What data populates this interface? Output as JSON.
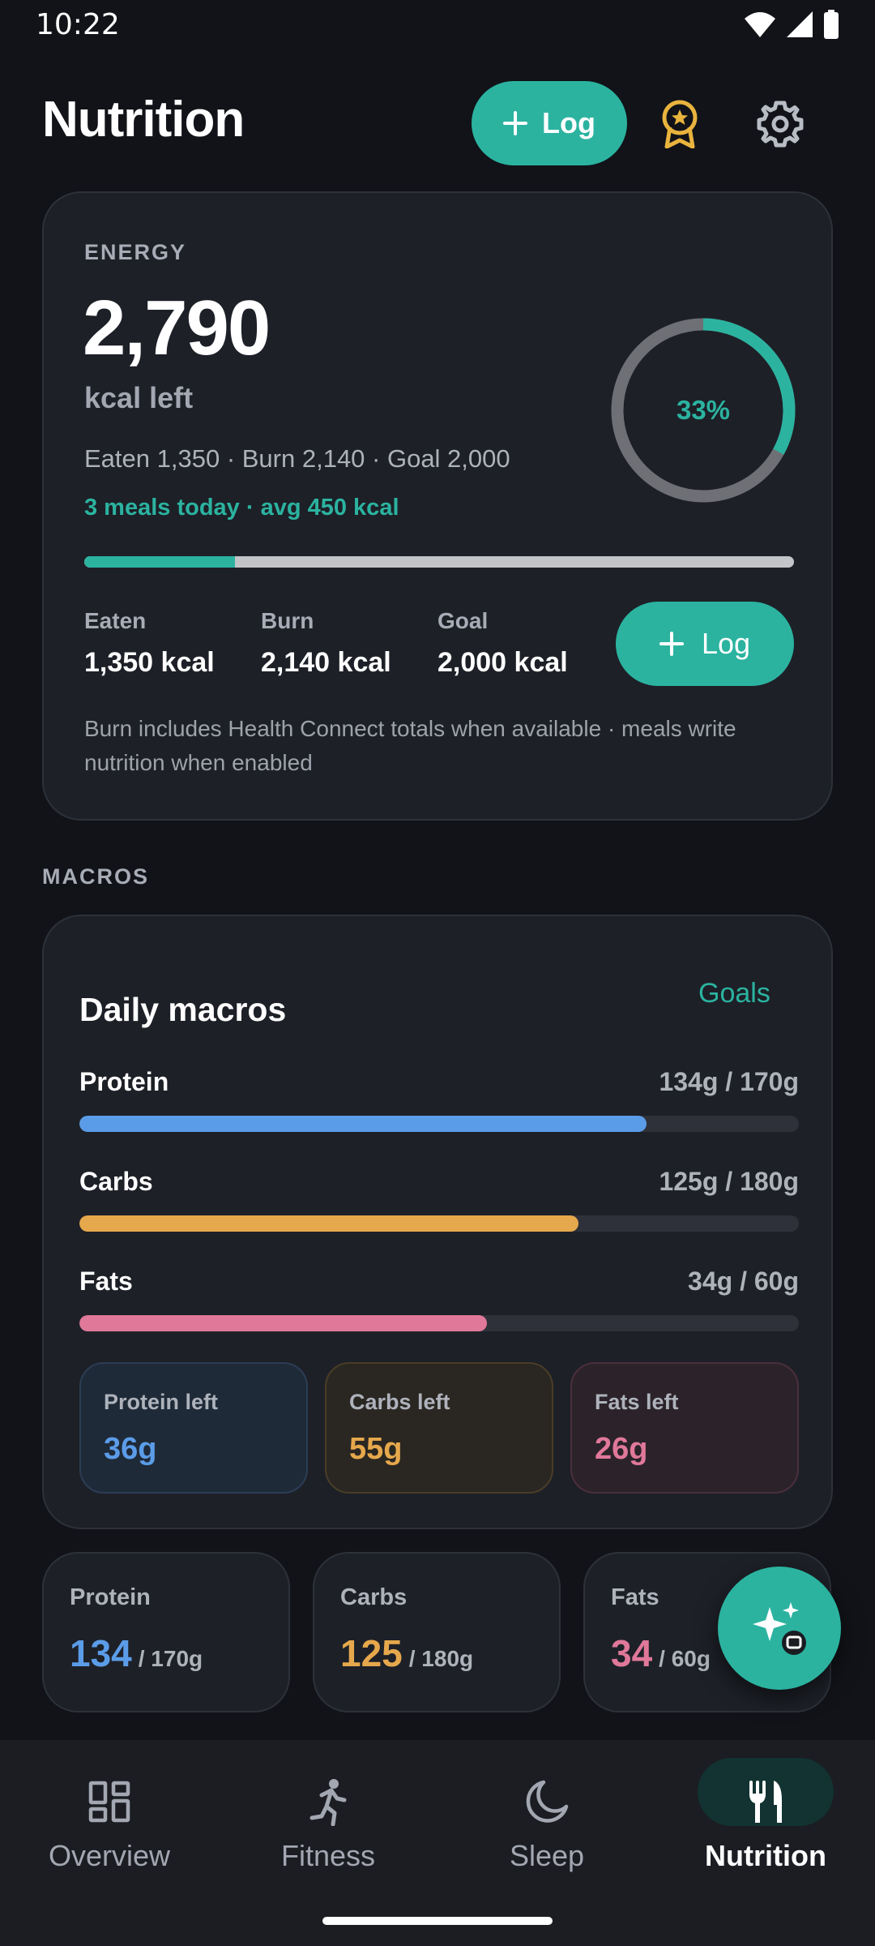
{
  "status_bar": {
    "time": "10:22"
  },
  "header": {
    "title": "Nutrition",
    "log_label": "Log"
  },
  "energy": {
    "eyebrow": "ENERGY",
    "remaining": "2,790",
    "unit": "kcal left",
    "summary": "Eaten 1,350 · Burn 2,140 · Goal 2,000",
    "meals": "3 meals today · avg 450 kcal",
    "ring_label": "33%",
    "ring_fraction": 0.33,
    "progress_fraction": 0.212,
    "stats": [
      {
        "label": "Eaten",
        "value": "1,350 kcal"
      },
      {
        "label": "Burn",
        "value": "2,140 kcal"
      },
      {
        "label": "Goal",
        "value": "2,000 kcal"
      }
    ],
    "log_label": "Log",
    "note": "Burn includes Health Connect totals when available · meals write nutrition when enabled"
  },
  "macros_section_label": "MACROS",
  "macros_card": {
    "title": "Daily macros",
    "goals_label": "Goals",
    "rows": [
      {
        "name": "Protein",
        "amount": "134g / 170g",
        "fraction": 0.788,
        "color": "#5b9ce8"
      },
      {
        "name": "Carbs",
        "amount": "125g / 180g",
        "fraction": 0.694,
        "color": "#e6a84c"
      },
      {
        "name": "Fats",
        "amount": "34g / 60g",
        "fraction": 0.567,
        "color": "#e0789a"
      }
    ],
    "left_tiles": [
      {
        "label": "Protein left",
        "value": "36g",
        "color": "#5b9ce8"
      },
      {
        "label": "Carbs left",
        "value": "55g",
        "color": "#e6a84c"
      },
      {
        "label": "Fats left",
        "value": "26g",
        "color": "#e0789a"
      }
    ]
  },
  "mini_cards": [
    {
      "label": "Protein",
      "value": "134",
      "goal": "/ 170g",
      "color": "#5b9ce8"
    },
    {
      "label": "Carbs",
      "value": "125",
      "goal": "/ 180g",
      "color": "#e6a84c"
    },
    {
      "label": "Fats",
      "value": "34",
      "goal": "/ 60g",
      "color": "#e0789a"
    }
  ],
  "nav": {
    "items": [
      {
        "label": "Overview",
        "icon": "dashboard-icon"
      },
      {
        "label": "Fitness",
        "icon": "running-icon"
      },
      {
        "label": "Sleep",
        "icon": "moon-icon"
      },
      {
        "label": "Nutrition",
        "icon": "utensils-icon",
        "active": true
      }
    ]
  },
  "colors": {
    "accent": "#2bb3a0",
    "background": "#111318",
    "card": "#1d2027"
  }
}
